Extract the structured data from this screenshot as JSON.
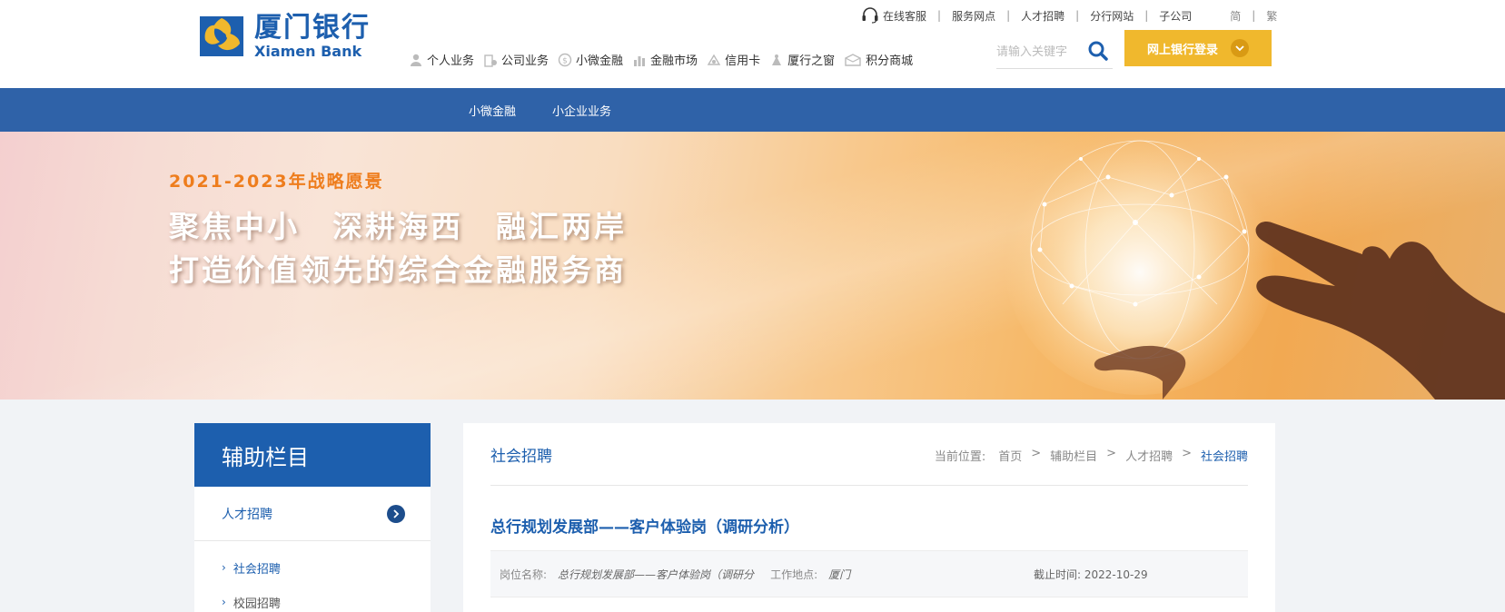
{
  "header": {
    "logo_cn": "厦门银行",
    "logo_en": "Xiamen Bank",
    "brand_color": "#1d5fae",
    "toplinks": [
      {
        "label": "在线客服",
        "icon": "headset-icon"
      },
      {
        "label": "服务网点"
      },
      {
        "label": "人才招聘"
      },
      {
        "label": "分行网站"
      },
      {
        "label": "子公司"
      }
    ],
    "lang_simplified": "简",
    "lang_traditional": "繁",
    "nav": [
      {
        "label": "个人业务",
        "icon": "person-icon"
      },
      {
        "label": "公司业务",
        "icon": "building-icon"
      },
      {
        "label": "小微金融",
        "icon": "coin-icon"
      },
      {
        "label": "金融市场",
        "icon": "chart-building-icon"
      },
      {
        "label": "信用卡",
        "icon": "card-icon"
      },
      {
        "label": "厦行之窗",
        "icon": "window-icon"
      },
      {
        "label": "积分商城",
        "icon": "gift-icon"
      }
    ],
    "search_placeholder": "请输入关键字",
    "login_label": "网上银行登录",
    "login_color": "#f0b82d"
  },
  "subnav": {
    "color": "#2f62a8",
    "items": [
      "小微金融",
      "小企业业务"
    ]
  },
  "banner": {
    "vision": "2021-2023年战略愿景",
    "slogan_line1": "聚焦中小　深耕海西　融汇两岸",
    "slogan_line2": "打造价值领先的综合金融服务商"
  },
  "sidebar": {
    "title": "辅助栏目",
    "section": "人才招聘",
    "subitems": [
      "社会招聘",
      "校园招聘"
    ]
  },
  "main": {
    "title": "社会招聘",
    "breadcrumb_label": "当前位置:",
    "breadcrumb": [
      "首页",
      "辅助栏目",
      "人才招聘",
      "社会招聘"
    ],
    "breadcrumb_sep": ">",
    "job_title": "总行规划发展部——客户体验岗（调研分析）",
    "job_row": {
      "position_label": "岗位名称:",
      "position_value": "总行规划发展部——客户体验岗（调研分",
      "location_label": "工作地点:",
      "location_value": "厦门",
      "deadline_label": "截止时间:",
      "deadline_value": "2022-10-29"
    }
  }
}
